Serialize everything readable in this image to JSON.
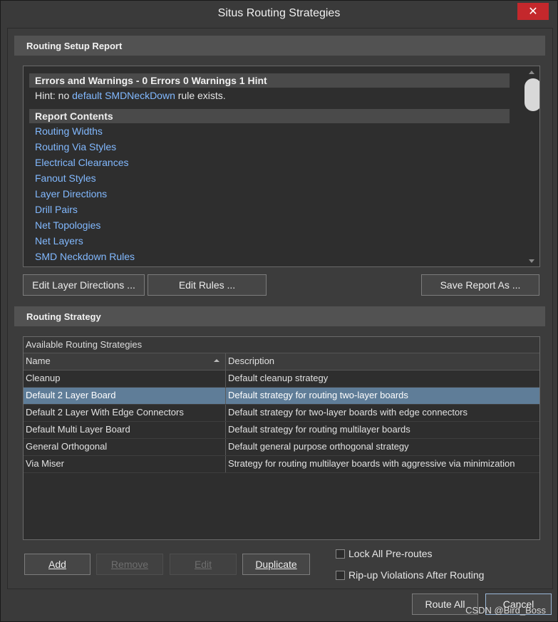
{
  "window": {
    "title": "Situs Routing Strategies",
    "close_symbol": "✕"
  },
  "setup_report": {
    "header": "Routing Setup Report",
    "errors_heading": "Errors and Warnings - 0 Errors 0 Warnings 1 Hint",
    "hint_prefix": "Hint: no ",
    "hint_link": "default SMDNeckDown",
    "hint_suffix": " rule exists.",
    "contents_heading": "Report Contents",
    "links": [
      "Routing Widths",
      "Routing Via Styles",
      "Electrical Clearances",
      "Fanout Styles",
      "Layer Directions",
      "Drill Pairs",
      "Net Topologies",
      "Net Layers",
      "SMD Neckdown Rules"
    ],
    "buttons": {
      "edit_layer_directions": "Edit Layer Directions ...",
      "edit_rules": "Edit Rules ...",
      "save_report": "Save Report As ..."
    }
  },
  "routing_strategy": {
    "header": "Routing Strategy",
    "table_caption": "Available Routing Strategies",
    "columns": [
      "Name",
      "Description"
    ],
    "rows": [
      {
        "name": "Cleanup",
        "description": "Default cleanup strategy",
        "selected": false
      },
      {
        "name": "Default 2 Layer Board",
        "description": "Default strategy for routing two-layer boards",
        "selected": true
      },
      {
        "name": "Default 2 Layer With Edge Connectors",
        "description": "Default strategy for two-layer boards with edge connectors",
        "selected": false
      },
      {
        "name": "Default Multi Layer Board",
        "description": "Default strategy for routing multilayer boards",
        "selected": false
      },
      {
        "name": "General Orthogonal",
        "description": "Default general purpose orthogonal strategy",
        "selected": false
      },
      {
        "name": "Via Miser",
        "description": "Strategy for routing multilayer boards with aggressive via minimization",
        "selected": false
      }
    ],
    "buttons": {
      "add": "Add",
      "remove": "Remove",
      "edit": "Edit",
      "duplicate": "Duplicate"
    },
    "checkboxes": {
      "lock_preroutes": "Lock All Pre-routes",
      "ripup_violations": "Rip-up Violations After Routing"
    }
  },
  "footer": {
    "route_all": "Route All",
    "cancel": "Cancel",
    "watermark": "CSDN @Bird_Boss"
  }
}
